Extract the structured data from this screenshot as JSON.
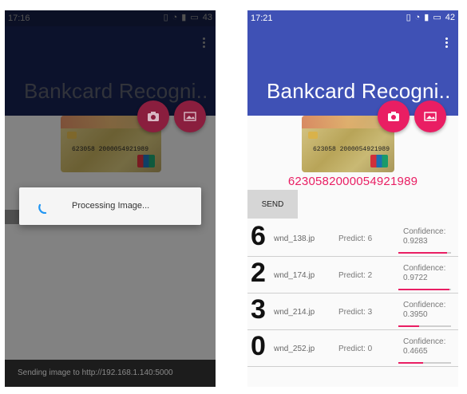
{
  "left_phone": {
    "status": {
      "time": "17:16",
      "battery": "43"
    },
    "title": "Bankcard Recogni..",
    "card": {
      "number": "623058 2000054921989"
    },
    "dialog": {
      "message": "Processing Image..."
    },
    "snackbar": {
      "text": "Sending image to http://192.168.1.140:5000"
    }
  },
  "right_phone": {
    "status": {
      "time": "17:21",
      "battery": "42"
    },
    "title": "Bankcard Recogni..",
    "card": {
      "number": "623058 2000054921989"
    },
    "result": "6230582000054921989",
    "send_label": "SEND",
    "rows": [
      {
        "digit": "6",
        "file": "wnd_138.jp",
        "predict": "Predict: 6",
        "conf_label": "Confidence:",
        "conf_value": "0.9283",
        "conf_fraction": 0.9283
      },
      {
        "digit": "2",
        "file": "wnd_174.jp",
        "predict": "Predict: 2",
        "conf_label": "Confidence:",
        "conf_value": "0.9722",
        "conf_fraction": 0.9722
      },
      {
        "digit": "3",
        "file": "wnd_214.jp",
        "predict": "Predict: 3",
        "conf_label": "Confidence:",
        "conf_value": "0.3950",
        "conf_fraction": 0.395
      },
      {
        "digit": "0",
        "file": "wnd_252.jp",
        "predict": "Predict: 0",
        "conf_label": "Confidence:",
        "conf_value": "0.4665",
        "conf_fraction": 0.4665
      }
    ]
  },
  "colors": {
    "primary": "#3f51b5",
    "accent": "#e91e63"
  }
}
